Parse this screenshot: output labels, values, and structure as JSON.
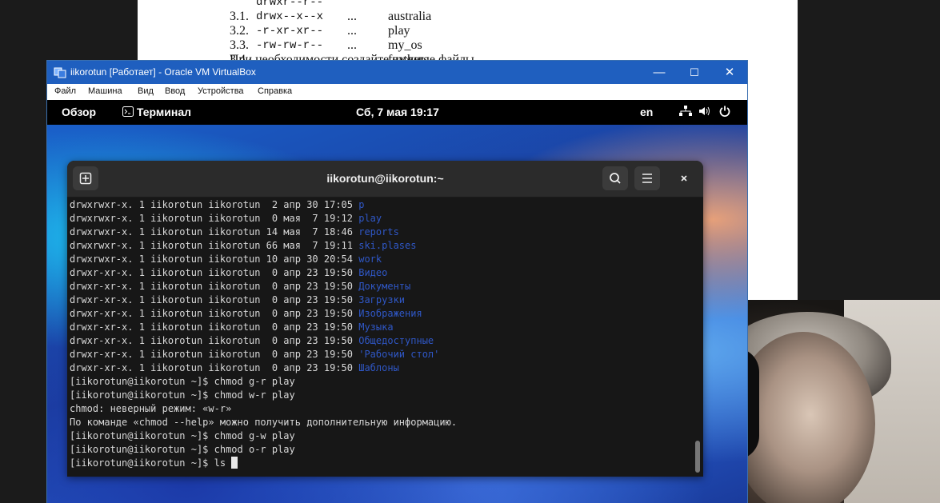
{
  "document": {
    "rows": [
      {
        "num": "3.1.",
        "perm": "drwxr--r--",
        "dots": "...",
        "name": "australia"
      },
      {
        "num": "3.2.",
        "perm": "drwx--x--x",
        "dots": "...",
        "name": "play"
      },
      {
        "num": "3.3.",
        "perm": "-r-xr-xr--",
        "dots": "...",
        "name": "my_os"
      },
      {
        "num": "3.4.",
        "perm": "-rw-rw-r--",
        "dots": "...",
        "name": "feathers"
      }
    ],
    "tail_text": "При необходимости создайте нужные файлы."
  },
  "vbox": {
    "title": "iikorotun [Работает] - Oracle VM VirtualBox",
    "minimize": "—",
    "maximize": "☐",
    "close": "✕",
    "menu": [
      "Файл",
      "Машина",
      "Вид",
      "Ввод",
      "Устройства",
      "Справка"
    ]
  },
  "gnome": {
    "overview": "Обзор",
    "app_name": "Терминал",
    "clock": "Сб, 7 мая  19:17",
    "lang": "en"
  },
  "terminal": {
    "title": "iikorotun@iikorotun:~",
    "lines": [
      {
        "text": "drwxrwxr-x. 1 iikorotun iikorotun  2 апр 30 17:05 ",
        "dir": "p"
      },
      {
        "text": "drwxrwxr-x. 1 iikorotun iikorotun  0 мая  7 19:12 ",
        "dir": "play"
      },
      {
        "text": "drwxrwxr-x. 1 iikorotun iikorotun 14 мая  7 18:46 ",
        "dir": "reports"
      },
      {
        "text": "drwxrwxr-x. 1 iikorotun iikorotun 66 мая  7 19:11 ",
        "dir": "ski.plases"
      },
      {
        "text": "drwxrwxr-x. 1 iikorotun iikorotun 10 апр 30 20:54 ",
        "dir": "work"
      },
      {
        "text": "drwxr-xr-x. 1 iikorotun iikorotun  0 апр 23 19:50 ",
        "dir": "Видео"
      },
      {
        "text": "drwxr-xr-x. 1 iikorotun iikorotun  0 апр 23 19:50 ",
        "dir": "Документы"
      },
      {
        "text": "drwxr-xr-x. 1 iikorotun iikorotun  0 апр 23 19:50 ",
        "dir": "Загрузки"
      },
      {
        "text": "drwxr-xr-x. 1 iikorotun iikorotun  0 апр 23 19:50 ",
        "dir": "Изображения"
      },
      {
        "text": "drwxr-xr-x. 1 iikorotun iikorotun  0 апр 23 19:50 ",
        "dir": "Музыка"
      },
      {
        "text": "drwxr-xr-x. 1 iikorotun iikorotun  0 апр 23 19:50 ",
        "dir": "Общедоступные"
      },
      {
        "text": "drwxr-xr-x. 1 iikorotun iikorotun  0 апр 23 19:50 ",
        "dir": "'Рабочий стол'"
      },
      {
        "text": "drwxr-xr-x. 1 iikorotun iikorotun  0 апр 23 19:50 ",
        "dir": "Шаблоны"
      },
      {
        "text": "[iikorotun@iikorotun ~]$ chmod g-r play",
        "dir": ""
      },
      {
        "text": "[iikorotun@iikorotun ~]$ chmod w-r play",
        "dir": ""
      },
      {
        "text": "chmod: неверный режим: «w-r»",
        "dir": ""
      },
      {
        "text": "По команде «chmod --help» можно получить дополнительную информацию.",
        "dir": ""
      },
      {
        "text": "[iikorotun@iikorotun ~]$ chmod g-w play",
        "dir": ""
      },
      {
        "text": "[iikorotun@iikorotun ~]$ chmod o-r play",
        "dir": ""
      }
    ],
    "prompt_line": "[iikorotun@iikorotun ~]$ ls "
  },
  "colors": {
    "vbox_title": "#1f5fbf",
    "dir_blue": "#2f57c6",
    "terminal_bg": "#171717"
  }
}
